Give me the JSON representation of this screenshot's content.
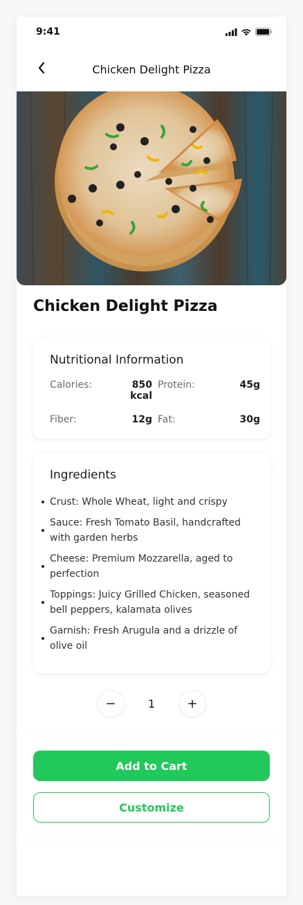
{
  "status_bar": {
    "time": "9:41"
  },
  "nav": {
    "title": "Chicken Delight Pizza"
  },
  "product": {
    "title": "Chicken Delight Pizza"
  },
  "nutrition": {
    "title": "Nutritional Information",
    "items": [
      {
        "label": "Calories:",
        "value": "850 kcal"
      },
      {
        "label": "Protein:",
        "value": "45g"
      },
      {
        "label": "Fiber:",
        "value": "12g"
      },
      {
        "label": "Fat:",
        "value": "30g"
      }
    ]
  },
  "ingredients": {
    "title": "Ingredients",
    "items": [
      "Crust: Whole Wheat, light and crispy",
      "Sauce: Fresh Tomato Basil, handcrafted with garden herbs",
      "Cheese: Premium Mozzarella, aged to perfection",
      "Toppings: Juicy Grilled Chicken, seasoned bell peppers, kalamata olives",
      "Garnish: Fresh Arugula and a drizzle of olive oil"
    ]
  },
  "quantity": {
    "minus": "−",
    "value": "1",
    "plus": "+"
  },
  "actions": {
    "add_to_cart": "Add to Cart",
    "customize": "Customize"
  },
  "colors": {
    "accent": "#20c95a"
  },
  "icons": {
    "back": "chevron-left-icon",
    "signal": "signal-icon",
    "wifi": "wifi-icon",
    "battery": "battery-icon",
    "hero": "pizza-image"
  }
}
